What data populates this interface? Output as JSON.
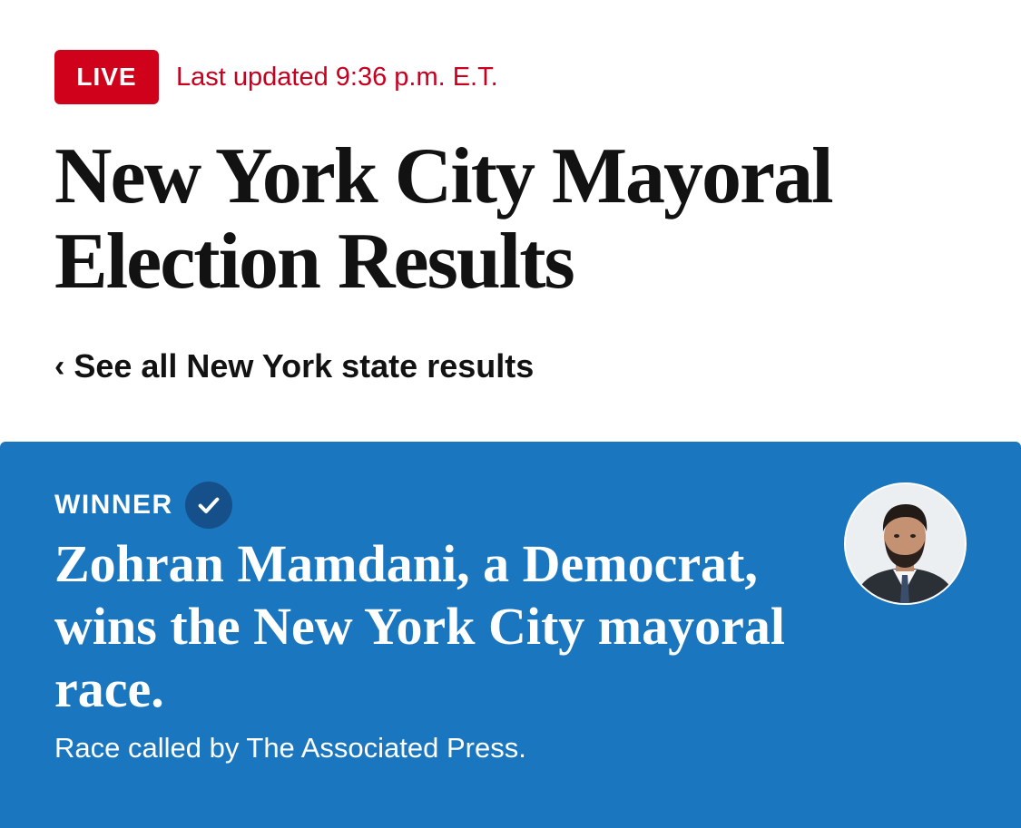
{
  "header": {
    "live_label": "LIVE",
    "updated_text": "Last updated 9:36 p.m. E.T."
  },
  "page_title": "New York City Mayoral Election Results",
  "back_link": {
    "label": "See all New York state results"
  },
  "winner_panel": {
    "label": "WINNER",
    "headline": "Zohran Mamdani, a Democrat, wins the New York City mayoral race.",
    "called_by": "Race called by The Associated Press."
  },
  "colors": {
    "live_red": "#d0021b",
    "updated_red": "#c6001e",
    "panel_blue": "#1a77bf",
    "check_circle": "#15508a",
    "title_text": "#121212"
  },
  "icons": {
    "back": "chevron-left-icon",
    "winner_check": "check-circle-icon"
  }
}
